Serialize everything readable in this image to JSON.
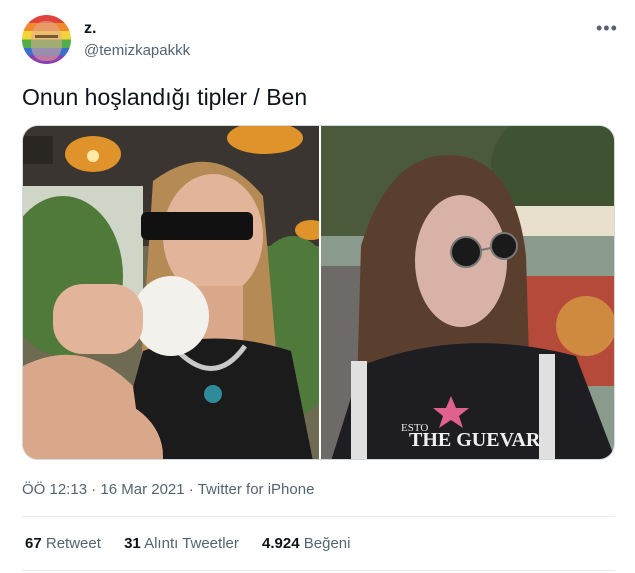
{
  "author": {
    "name": "z.",
    "handle": "@temizkapakkk"
  },
  "more_icon": "•••",
  "tweet_text": "Onun hoşlandığı tipler /  Ben",
  "media": {
    "left_photo_text": "",
    "right_photo_shirt_text": "THE GUEVAR",
    "right_photo_shirt_text_top": "ESTO"
  },
  "meta": {
    "time": "ÖÖ 12:13",
    "sep1": "·",
    "date": "16 Mar 2021",
    "sep2": "·",
    "source": "Twitter for iPhone"
  },
  "stats": [
    {
      "count": "67",
      "label": "Retweet"
    },
    {
      "count": "31",
      "label": "Alıntı Tweetler"
    },
    {
      "count": "4.924",
      "label": "Beğeni"
    }
  ],
  "colors": {
    "text": "#0f1419",
    "secondary": "#536471",
    "border": "#cfd9de"
  }
}
